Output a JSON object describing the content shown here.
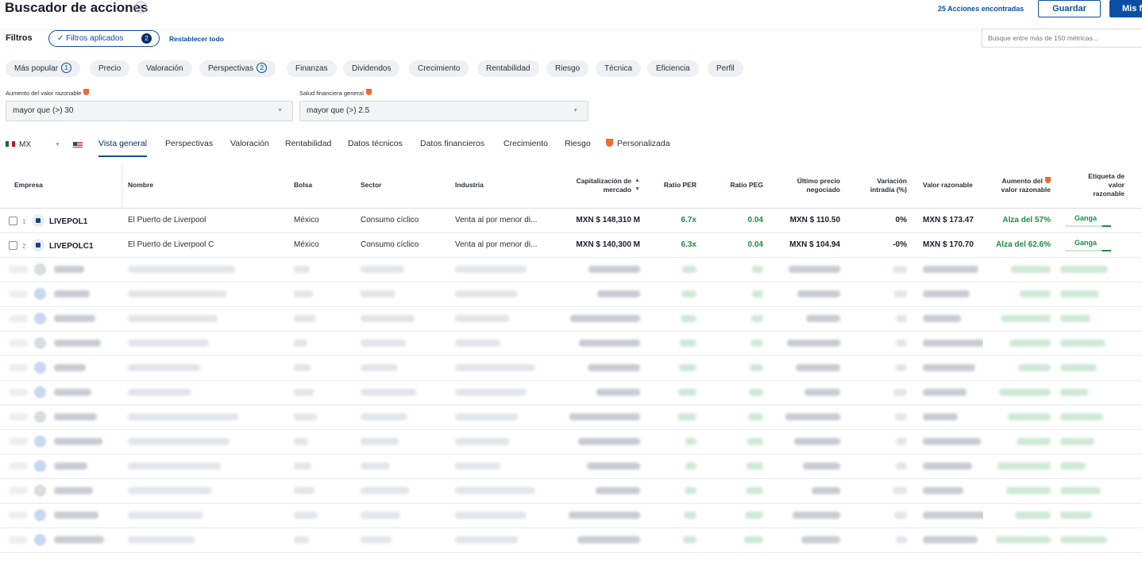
{
  "header": {
    "title": "Buscador de acciones",
    "info_icon": "info-icon",
    "found_text": "25 Acciones encontradas",
    "save_label": "Guardar",
    "mis_label": "Mis f"
  },
  "filters_bar": {
    "label": "Filtros",
    "applied_label": "Filtros aplicados",
    "applied_count": "2",
    "reset_label": "Restablecer todo",
    "metric_search_placeholder": "Busque entre más de 150 métricas..."
  },
  "chips": [
    {
      "label": "Más popular",
      "badge": "1"
    },
    {
      "label": "Precio",
      "badge": ""
    },
    {
      "label": "Valoración",
      "badge": ""
    },
    {
      "label": "Perspectivas",
      "badge": "2"
    },
    {
      "label": "Finanzas",
      "badge": ""
    },
    {
      "label": "Dividendos",
      "badge": ""
    },
    {
      "label": "Crecimiento",
      "badge": ""
    },
    {
      "label": "Rentabilidad",
      "badge": ""
    },
    {
      "label": "Riesgo",
      "badge": ""
    },
    {
      "label": "Técnica",
      "badge": ""
    },
    {
      "label": "Eficiencia",
      "badge": ""
    },
    {
      "label": "Perfil",
      "badge": ""
    }
  ],
  "active_filters": [
    {
      "label": "Aumento del valor razonable",
      "value": "mayor que (>) 30"
    },
    {
      "label": "Salud financiera general",
      "value": "mayor que (>) 2.5"
    }
  ],
  "country": {
    "code": "MX"
  },
  "view_tabs": [
    {
      "label": "Vista general",
      "active": true
    },
    {
      "label": "Perspectivas",
      "active": false
    },
    {
      "label": "Valoración",
      "active": false
    },
    {
      "label": "Rentabilidad",
      "active": false
    },
    {
      "label": "Datos técnicos",
      "active": false
    },
    {
      "label": "Datos financieros",
      "active": false
    },
    {
      "label": "Crecimiento",
      "active": false
    },
    {
      "label": "Riesgo",
      "active": false
    },
    {
      "label": "Personalizada",
      "active": false
    }
  ],
  "table": {
    "columns": {
      "empresa": "Empresa",
      "nombre": "Nombre",
      "bolsa": "Bolsa",
      "sector": "Sector",
      "industria": "Industria",
      "cap_line1": "Capitalización de",
      "cap_line2": "mercado",
      "per": "Ratio PER",
      "peg": "Ratio PEG",
      "precio_line1": "Último precio",
      "precio_line2": "negociado",
      "var_line1": "Variación",
      "var_line2": "intradía (%)",
      "valor": "Valor razonable",
      "aumento_line1": "Aumento del",
      "aumento_line2": "valor razonable",
      "etiqueta_line1": "Etiqueta de",
      "etiqueta_line2": "valor",
      "etiqueta_line3": "razonable"
    },
    "rows": [
      {
        "num": "1",
        "ticker": "LIVEPOL1",
        "nombre": "El Puerto de Liverpool",
        "bolsa": "México",
        "sector": "Consumo cíclico",
        "industria": "Venta al por menor di...",
        "cap": "MXN $ 148,310 M",
        "per": "6.7x",
        "peg": "0.04",
        "precio": "MXN $ 110.50",
        "var": "0%",
        "valor": "MXN $ 173.47",
        "aumento": "Alza del 57%",
        "etiqueta": "Ganga"
      },
      {
        "num": "2",
        "ticker": "LIVEPOLC1",
        "nombre": "El Puerto de Liverpool C",
        "bolsa": "México",
        "sector": "Consumo cíclico",
        "industria": "Venta al por menor di...",
        "cap": "MXN $ 140,300 M",
        "per": "6.3x",
        "peg": "0.04",
        "precio": "MXN $ 104.94",
        "var": "-0%",
        "valor": "MXN $ 170.70",
        "aumento": "Alza del 62.6%",
        "etiqueta": "Ganga"
      }
    ],
    "blurred_row_count": 12
  },
  "colors": {
    "accent": "#0a4fa3",
    "accent_dark": "#0a2e63",
    "positive": "#1e8e3e",
    "premium_shield": "#f06a2a"
  }
}
